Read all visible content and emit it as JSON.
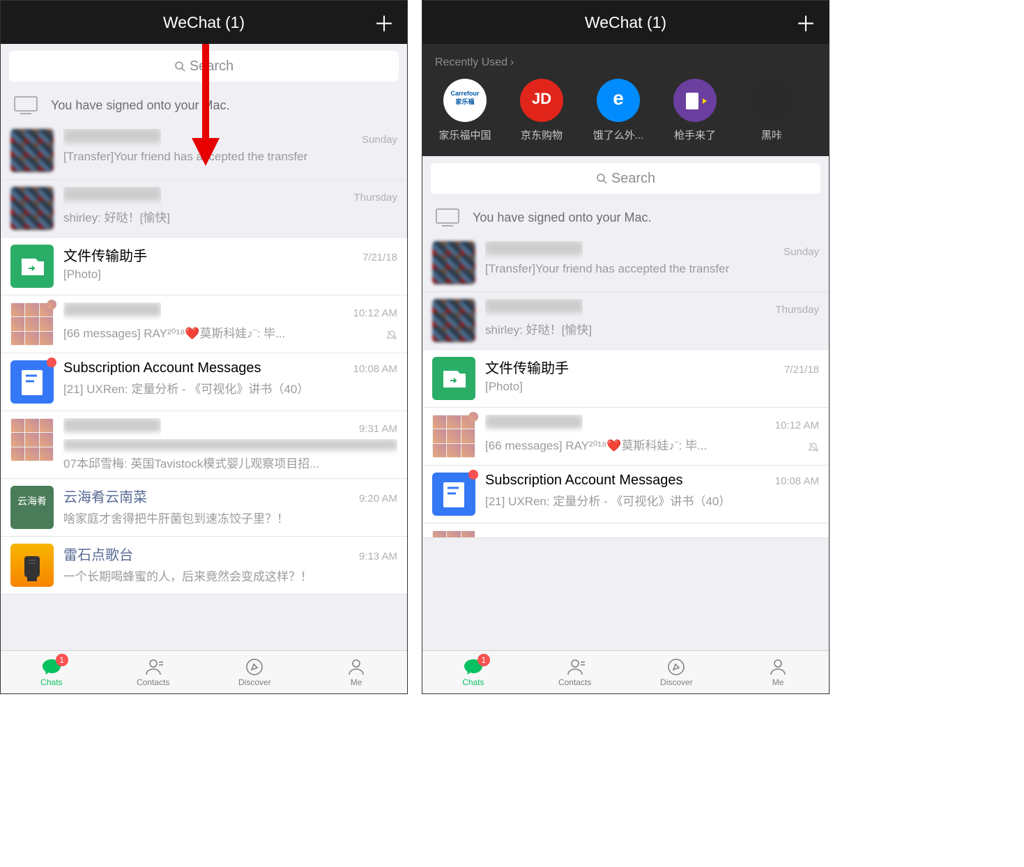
{
  "header": {
    "title": "WeChat (1)"
  },
  "search": {
    "placeholder": "Search"
  },
  "mac_bar": {
    "text": "You have signed onto your Mac."
  },
  "recent": {
    "header": "Recently Used",
    "apps": [
      {
        "name": "家乐福中国",
        "color": "#0055a4"
      },
      {
        "name": "京东购物",
        "color": "#e1251b"
      },
      {
        "name": "饿了么外...",
        "color": "#008cff"
      },
      {
        "name": "枪手来了",
        "color": "#6b3fa0"
      },
      {
        "name": "黑咔",
        "color": "#2a2a2a"
      }
    ]
  },
  "chats": [
    {
      "name_blurred": true,
      "time": "Sunday",
      "msg": "[Transfer]Your friend has accepted the transfer",
      "pinned": true,
      "avatar": "pixelated1"
    },
    {
      "name_blurred": true,
      "time": "Thursday",
      "msg": "shirley: 好哒！[愉快]",
      "pinned": true,
      "avatar": "pixelated2"
    },
    {
      "name": "文件传输助手",
      "time": "7/21/18",
      "msg": "[Photo]",
      "avatar": "file-transfer"
    },
    {
      "name_blurred": true,
      "time": "10:12 AM",
      "msg": "[66 messages]  RAY²⁰¹⁸❤️莫斯科娃♪¨: 毕...",
      "avatar": "grid",
      "badge": true,
      "mute": true
    },
    {
      "name": "Subscription Account Messages",
      "time": "10:08 AM",
      "msg": "[21] UXRen: 定量分析 - 《可视化》讲书（40）",
      "avatar": "subscription",
      "badge": true
    },
    {
      "name_blurred": true,
      "msg_blurred_prefix": true,
      "time": "9:31 AM",
      "msg": "07本邱雪梅: 英国Tavistock模式婴儿观察项目招...",
      "avatar": "grid"
    },
    {
      "name": "云海肴云南菜",
      "time": "9:20 AM",
      "msg": "啥家庭才舍得把牛肝菌包到速冻饺子里？！",
      "avatar": "yunhai",
      "link": true
    },
    {
      "name": "雷石点歌台",
      "time": "9:13 AM",
      "msg": "一个长期喝蜂蜜的人，后来竟然会变成这样？！",
      "avatar": "leishi",
      "link": true
    }
  ],
  "tabs": {
    "chats": "Chats",
    "contacts": "Contacts",
    "discover": "Discover",
    "me": "Me",
    "badge": "1"
  }
}
